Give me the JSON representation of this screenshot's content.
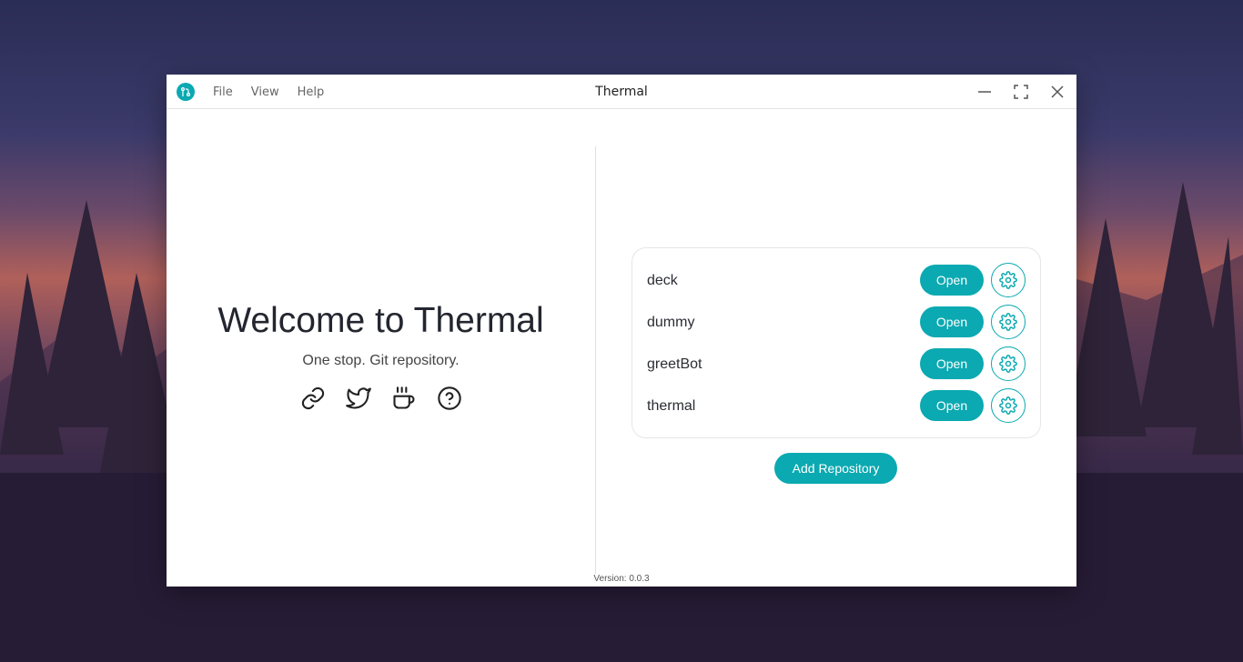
{
  "window": {
    "title": "Thermal"
  },
  "menu": {
    "items": [
      "File",
      "View",
      "Help"
    ]
  },
  "welcome": {
    "heading": "Welcome to Thermal",
    "tagline": "One stop. Git repository."
  },
  "social_icons": [
    "link-icon",
    "twitter-icon",
    "coffee-icon",
    "help-circle-icon"
  ],
  "repositories": [
    {
      "name": "deck",
      "open_label": "Open"
    },
    {
      "name": "dummy",
      "open_label": "Open"
    },
    {
      "name": "greetBot",
      "open_label": "Open"
    },
    {
      "name": "thermal",
      "open_label": "Open"
    }
  ],
  "add_repository_label": "Add Repository",
  "version_text": "Version: 0.0.3",
  "colors": {
    "accent": "#0ba9b1",
    "text": "#23262f"
  }
}
